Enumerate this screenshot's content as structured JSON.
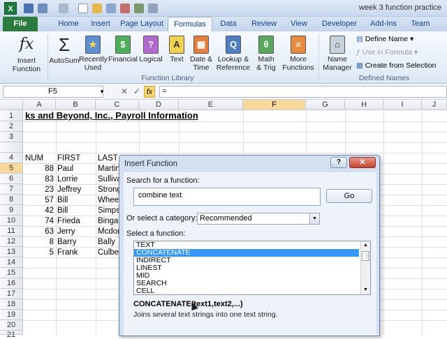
{
  "window": {
    "title": "week 3 function practice"
  },
  "tabs": [
    "File",
    "Home",
    "Insert",
    "Page Layout",
    "Formulas",
    "Data",
    "Review",
    "View",
    "Developer",
    "Add-Ins",
    "Team"
  ],
  "active_tab": "Formulas",
  "ribbon": {
    "buttons": [
      {
        "label": "Insert\nFunction",
        "icon": "fx-icon",
        "glyph": "fx"
      },
      {
        "label": "AutoSum",
        "icon": "sigma-icon",
        "glyph": "Σ"
      },
      {
        "label": "Recently\nUsed",
        "icon": "star-book-icon",
        "glyph": "★"
      },
      {
        "label": "Financial",
        "icon": "financial-book-icon",
        "glyph": "$"
      },
      {
        "label": "Logical",
        "icon": "logical-book-icon",
        "glyph": "?"
      },
      {
        "label": "Text",
        "icon": "text-book-icon",
        "glyph": "A"
      },
      {
        "label": "Date &\nTime",
        "icon": "date-book-icon",
        "glyph": "▦"
      },
      {
        "label": "Lookup &\nReference",
        "icon": "lookup-book-icon",
        "glyph": "Q"
      },
      {
        "label": "Math\n& Trig",
        "icon": "math-book-icon",
        "glyph": "θ"
      },
      {
        "label": "More\nFunctions",
        "icon": "more-book-icon",
        "glyph": "≡"
      },
      {
        "label": "Name\nManager",
        "icon": "name-manager-icon",
        "glyph": "⌂"
      }
    ],
    "group_function_library": "Function Library",
    "group_defined_names": "Defined Names",
    "define_name": "Define Name",
    "use_in_formula": "Use in Formula",
    "create_from_selection": "Create from Selection"
  },
  "formula_bar": {
    "name_box": "F5",
    "formula": "="
  },
  "grid": {
    "columns": [
      "A",
      "B",
      "C",
      "D",
      "E",
      "F",
      "G",
      "H",
      "I"
    ],
    "rows": [
      "1",
      "2",
      "3",
      "4",
      "5",
      "6",
      "7",
      "8",
      "9",
      "10",
      "11",
      "12",
      "13",
      "14",
      "15",
      "16",
      "17",
      "18",
      "19",
      "20",
      "21"
    ],
    "title": "ks and Beyond, Inc., Payroll Information",
    "headers": [
      "NUM",
      "FIRST",
      "LAST"
    ],
    "records": [
      {
        "num": "88",
        "first": "Paul",
        "last": "Martin"
      },
      {
        "num": "83",
        "first": "Lorrie",
        "last": "Sulliva"
      },
      {
        "num": "23",
        "first": "Jeffrey",
        "last": "Strong"
      },
      {
        "num": "57",
        "first": "Bill",
        "last": "Wheel"
      },
      {
        "num": "42",
        "first": "Bill",
        "last": "Simps"
      },
      {
        "num": "74",
        "first": "Frieda",
        "last": "Binga"
      },
      {
        "num": "63",
        "first": "Jerry",
        "last": "Mcdon"
      },
      {
        "num": "8",
        "first": "Barry",
        "last": "Bally"
      },
      {
        "num": "5",
        "first": "Frank",
        "last": "Culbe"
      }
    ]
  },
  "dialog": {
    "title": "Insert Function",
    "help": "?",
    "close": "✕",
    "search_label": "Search for a function:",
    "search_value": "combine text",
    "go": "Go",
    "category_label": "Or select a category:",
    "category_value": "Recommended",
    "select_label": "Select a function:",
    "functions": [
      "TEXT",
      "CONCATENATE",
      "INDIRECT",
      "LINEST",
      "MID",
      "SEARCH",
      "CELL"
    ],
    "selected": "CONCATENATE",
    "signature": "CONCATENATE(text1,text2,...)",
    "description": "Joins several text strings into one text string."
  }
}
